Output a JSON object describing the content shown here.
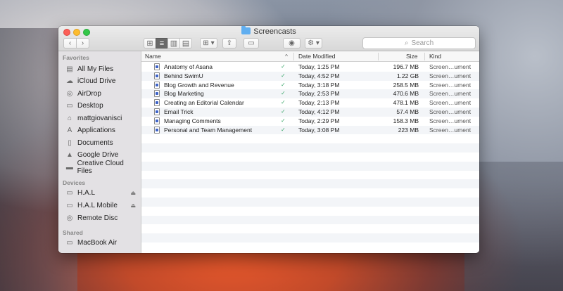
{
  "window": {
    "title": "Screencasts"
  },
  "toolbar": {
    "back": "‹",
    "forward": "›",
    "share": "⇪",
    "tag": "▭",
    "quicklook": "◉",
    "action": "⚙ ▾",
    "arrange": "⊞ ▾",
    "view_icons": "⊞",
    "view_list": "≡",
    "view_columns": "▥",
    "view_coverflow": "▤"
  },
  "search": {
    "placeholder": "Search"
  },
  "sidebar": {
    "favorites_heading": "Favorites",
    "favorites": [
      {
        "label": "All My Files",
        "icon": "all-files-icon"
      },
      {
        "label": "iCloud Drive",
        "icon": "cloud-icon"
      },
      {
        "label": "AirDrop",
        "icon": "airdrop-icon"
      },
      {
        "label": "Desktop",
        "icon": "desktop-icon"
      },
      {
        "label": "mattgiovanisci",
        "icon": "home-icon"
      },
      {
        "label": "Applications",
        "icon": "applications-icon"
      },
      {
        "label": "Documents",
        "icon": "documents-icon"
      },
      {
        "label": "Google Drive",
        "icon": "google-drive-icon"
      },
      {
        "label": "Creative Cloud Files",
        "icon": "folder-icon"
      }
    ],
    "devices_heading": "Devices",
    "devices": [
      {
        "label": "H.A.L",
        "icon": "disk-icon",
        "eject": "⏏"
      },
      {
        "label": "H.A.L Mobile",
        "icon": "disk-icon",
        "eject": "⏏"
      },
      {
        "label": "Remote Disc",
        "icon": "disc-icon",
        "eject": ""
      }
    ],
    "shared_heading": "Shared",
    "shared": [
      {
        "label": "MacBook Air",
        "icon": "laptop-icon"
      }
    ]
  },
  "columns": {
    "name": "Name",
    "sort_indicator": "^",
    "date": "Date Modified",
    "size": "Size",
    "kind": "Kind"
  },
  "files": [
    {
      "name": "Anatomy of Asana",
      "status": "✓",
      "date": "Today, 1:25 PM",
      "size": "196.7 MB",
      "kind": "Screen…ument"
    },
    {
      "name": "Behind SwimU",
      "status": "✓",
      "date": "Today, 4:52 PM",
      "size": "1.22 GB",
      "kind": "Screen…ument"
    },
    {
      "name": "Blog Growth and Revenue",
      "status": "✓",
      "date": "Today, 3:18 PM",
      "size": "258.5 MB",
      "kind": "Screen…ument"
    },
    {
      "name": "Blog Marketing",
      "status": "✓",
      "date": "Today, 2:53 PM",
      "size": "470.6 MB",
      "kind": "Screen…ument"
    },
    {
      "name": "Creating an Editorial Calendar",
      "status": "✓",
      "date": "Today, 2:13 PM",
      "size": "478.1 MB",
      "kind": "Screen…ument"
    },
    {
      "name": "Email Trick",
      "status": "✓",
      "date": "Today, 4:12 PM",
      "size": "57.4 MB",
      "kind": "Screen…ument"
    },
    {
      "name": "Managing Comments",
      "status": "✓",
      "date": "Today, 2:29 PM",
      "size": "158.3 MB",
      "kind": "Screen…ument"
    },
    {
      "name": "Personal and Team Management",
      "status": "✓",
      "date": "Today, 3:08 PM",
      "size": "223 MB",
      "kind": "Screen…ument"
    }
  ],
  "empty_rows": 13
}
